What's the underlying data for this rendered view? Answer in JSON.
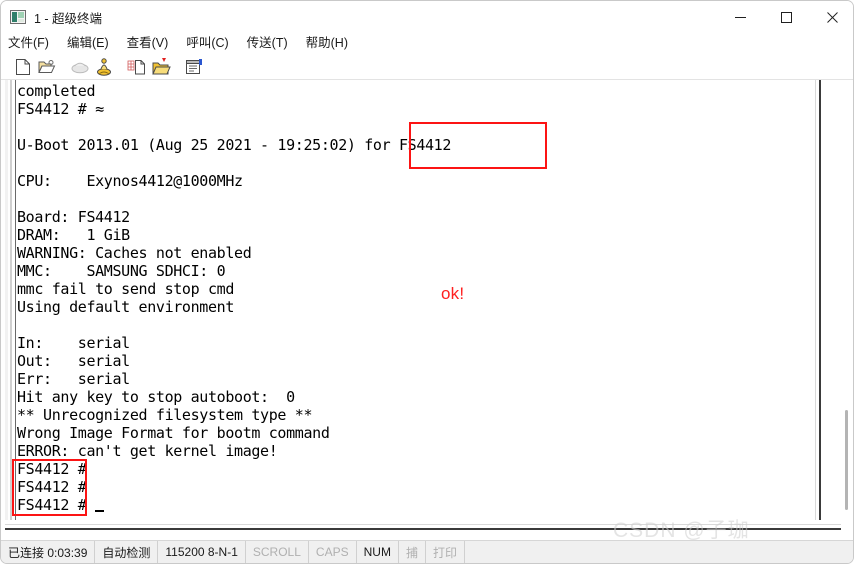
{
  "window": {
    "title": "1 - 超级终端",
    "icon": "hyperterminal-icon",
    "controls": {
      "minimize": "minimize-icon",
      "maximize": "maximize-icon",
      "close": "close-icon"
    }
  },
  "menu": {
    "items": [
      {
        "label": "文件(F)",
        "name": "menu-file"
      },
      {
        "label": "编辑(E)",
        "name": "menu-edit"
      },
      {
        "label": "查看(V)",
        "name": "menu-view"
      },
      {
        "label": "呼叫(C)",
        "name": "menu-call"
      },
      {
        "label": "传送(T)",
        "name": "menu-transfer"
      },
      {
        "label": "帮助(H)",
        "name": "menu-help"
      }
    ]
  },
  "toolbar": {
    "buttons": [
      {
        "name": "new-connection-icon",
        "title": "新建连接"
      },
      {
        "name": "open-connection-icon",
        "title": "打开"
      },
      {
        "name": "disconnect-icon",
        "title": "断开",
        "disabled": true
      },
      {
        "name": "call-icon",
        "title": "呼叫"
      },
      {
        "name": "send-file-icon",
        "title": "传送"
      },
      {
        "name": "receive-file-icon",
        "title": "接收"
      },
      {
        "name": "properties-icon",
        "title": "属性"
      }
    ]
  },
  "terminal": {
    "lines": [
      "completed",
      "FS4412 # ≈",
      "",
      "U-Boot 2013.01 (Aug 25 2021 - 19:25:02) for FS4412",
      "",
      "CPU:    Exynos4412@1000MHz",
      "",
      "Board: FS4412",
      "DRAM:   1 GiB",
      "WARNING: Caches not enabled",
      "MMC:    SAMSUNG SDHCI: 0",
      "mmc fail to send stop cmd",
      "Using default environment",
      "",
      "In:    serial",
      "Out:   serial",
      "Err:   serial",
      "Hit any key to stop autoboot:  0",
      "** Unrecognized filesystem type **",
      "Wrong Image Format for bootm command",
      "ERROR: can't get kernel image!",
      "FS4412 # ",
      "FS4412 # ",
      "FS4412 # "
    ],
    "cursor": "text-cursor"
  },
  "annotations": {
    "ok_label": "ok!",
    "highlight_color": "#fc1414",
    "ok_color": "#ff2020",
    "box_for_fs4412": "for FS4412",
    "box_prompts": "FS4412"
  },
  "watermark": {
    "text": "CSDN @子珈"
  },
  "statusbar": {
    "connected": "已连接 0:03:39",
    "detect": "自动检测",
    "serial": "115200 8-N-1",
    "scroll": "SCROLL",
    "caps": "CAPS",
    "num": "NUM",
    "capture": "捕",
    "print": "打印"
  }
}
